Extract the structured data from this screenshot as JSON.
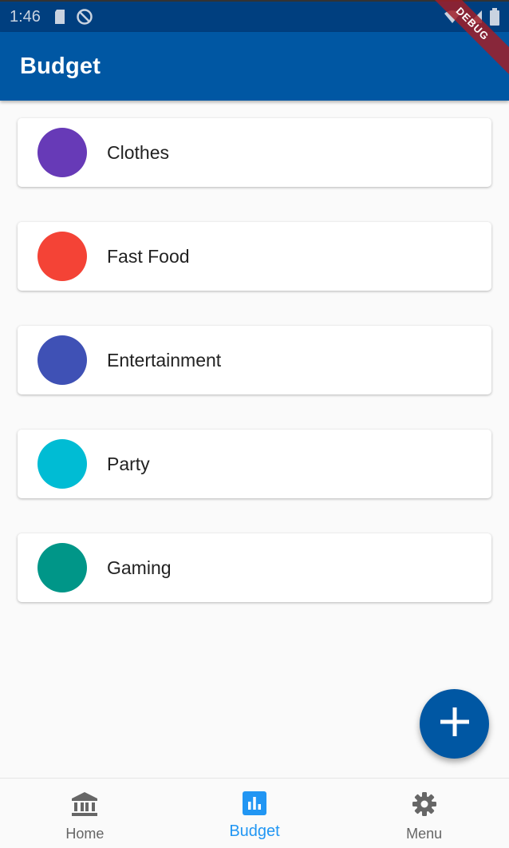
{
  "status_bar": {
    "time": "1:46",
    "icons": [
      "sd-card-icon",
      "do-not-disturb-icon",
      "wifi-icon",
      "signal-icon",
      "battery-icon"
    ]
  },
  "debug_banner": "DEBUG",
  "app_bar": {
    "title": "Budget"
  },
  "categories": [
    {
      "label": "Clothes",
      "color": "#673ab7"
    },
    {
      "label": "Fast Food",
      "color": "#f44336"
    },
    {
      "label": "Entertainment",
      "color": "#3f51b5"
    },
    {
      "label": "Party",
      "color": "#00bcd4"
    },
    {
      "label": "Gaming",
      "color": "#009688"
    }
  ],
  "fab": {
    "icon": "plus-icon"
  },
  "bottom_nav": {
    "items": [
      {
        "label": "Home",
        "icon": "bank-icon",
        "active": false
      },
      {
        "label": "Budget",
        "icon": "bar-chart-icon",
        "active": true
      },
      {
        "label": "Menu",
        "icon": "gear-icon",
        "active": false
      }
    ]
  },
  "colors": {
    "primary": "#0057a3",
    "status_bar": "#003f7f",
    "accent": "#2196f3"
  }
}
